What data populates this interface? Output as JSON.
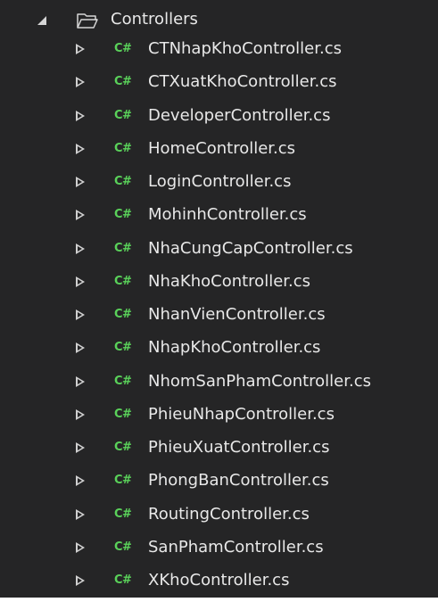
{
  "tree": {
    "folder": {
      "label": "Controllers",
      "icon": "folder-open-icon",
      "expand_icon": "expanded-triangle-icon"
    },
    "file_icon": "csharp-file-icon",
    "file_icon_text": "C#",
    "file_icon_color": "#5ad25a",
    "files": [
      "CTNhapKhoController.cs",
      "CTXuatKhoController.cs",
      "DeveloperController.cs",
      "HomeController.cs",
      "LoginController.cs",
      "MohinhController.cs",
      "NhaCungCapController.cs",
      "NhaKhoController.cs",
      "NhanVienController.cs",
      "NhapKhoController.cs",
      "NhomSanPhamController.cs",
      "PhieuNhapController.cs",
      "PhieuXuatController.cs",
      "PhongBanController.cs",
      "RoutingController.cs",
      "SanPhamController.cs",
      "XKhoController.cs"
    ]
  },
  "colors": {
    "background": "#252526",
    "text": "#e8e8e8",
    "folder": "#d6d6d6"
  }
}
